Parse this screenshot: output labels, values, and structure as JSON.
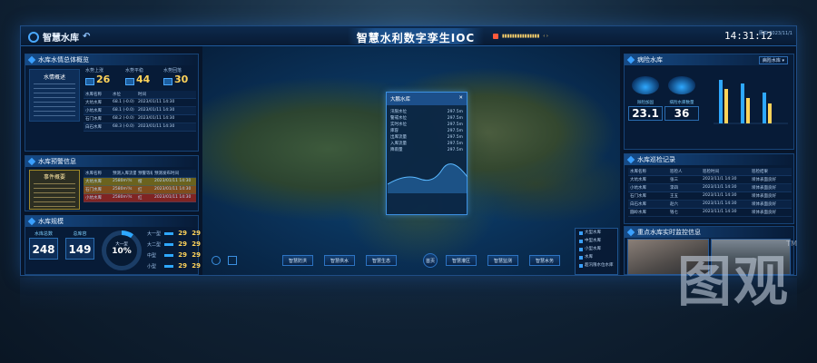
{
  "header": {
    "brand": "智慧水库",
    "title": "智慧水利数字孪生IOC",
    "time": "14:31:12",
    "date_small": "周四 2023/11/1"
  },
  "colors": {
    "accent": "#2ea8ff",
    "warning": "#ffd35a",
    "danger": "#ff5a3c"
  },
  "left": {
    "overview": {
      "title": "水库水情总体概览",
      "box_title": "水情概述",
      "stats": [
        {
          "label": "水势上涨",
          "value": "26"
        },
        {
          "label": "水势平稳",
          "value": "44"
        },
        {
          "label": "水势回落",
          "value": "30"
        }
      ],
      "table_header": [
        "水库名称",
        "水位",
        "时间"
      ],
      "table_rows": [
        [
          "大坑水库",
          "68.1 (-0.0)",
          "2023/01/11 14:30"
        ],
        [
          "小坑水库",
          "68.1 (-0.0)",
          "2023/01/11 14:30"
        ],
        [
          "石门水库",
          "68.2 (-0.0)",
          "2023/01/11 14:30"
        ],
        [
          "白石水库",
          "68.3 (-0.0)",
          "2023/01/11 14:30"
        ]
      ]
    },
    "warning": {
      "title": "水库预警信息",
      "box_title": "事件概要",
      "table_header": [
        "水库名称",
        "预测入库流量",
        "预警等级",
        "预测发布时间"
      ],
      "table_rows": [
        [
          "大坑水库",
          "2580m³/s",
          "橙",
          "2023/01/11 14:30"
        ],
        [
          "石门水库",
          "2580m³/s",
          "红",
          "2023/01/11 14:30"
        ],
        [
          "小坑水库",
          "2580m³/s",
          "红",
          "2023/01/11 14:30"
        ]
      ]
    },
    "scale": {
      "title": "水库规模",
      "total_label": "水库总数",
      "total": "248",
      "capacity_label": "总库容",
      "capacity": "149",
      "donut_label": "大一型",
      "donut_value": "10%",
      "donut_fraction": 0.1,
      "legend": [
        {
          "label": "大一型",
          "value": "29",
          "v2": "29"
        },
        {
          "label": "大二型",
          "value": "29",
          "v2": "29"
        },
        {
          "label": "中型",
          "value": "29",
          "v2": "29"
        },
        {
          "label": "小型",
          "value": "29",
          "v2": "29"
        }
      ]
    }
  },
  "popup": {
    "title": "大鹏水库",
    "kv": [
      [
        "汛限水位",
        "297.5m"
      ],
      [
        "警戒水位",
        "297.5m"
      ],
      [
        "实时水位",
        "297.5m"
      ],
      [
        "库容",
        "297.5m"
      ],
      [
        "出库流量",
        "297.5m"
      ],
      [
        "入库流量",
        "297.5m"
      ],
      [
        "降雨量",
        "297.5m"
      ]
    ]
  },
  "bottom_buttons": [
    "智慧防洪",
    "智慧供水",
    "智慧生态",
    "首页",
    "智慧灌区",
    "智慧监测",
    "智慧水务"
  ],
  "map_legend": [
    "大型水库",
    "中型水库",
    "小型水库",
    "水库",
    "超汛限水位水库"
  ],
  "right": {
    "reservoir": {
      "title": "病险水库",
      "select_value": "病险水库",
      "left_label": "除险加固",
      "left_value": "23.1",
      "right_label": "病险水库数量",
      "right_value": "36"
    },
    "patrol": {
      "title": "水库巡检记录",
      "table_header": [
        "水库名称",
        "巡检人",
        "巡检时间",
        "巡检结果"
      ],
      "table_rows": [
        [
          "大坑水库",
          "张三",
          "2023/11/1 14:30",
          "坝体表面良好"
        ],
        [
          "小坑水库",
          "李四",
          "2023/11/1 14:30",
          "坝体表面良好"
        ],
        [
          "石门水库",
          "王五",
          "2023/11/1 14:30",
          "坝体表面良好"
        ],
        [
          "白石水库",
          "赵六",
          "2023/11/1 14:30",
          "坝体表面良好"
        ],
        [
          "圆岭水库",
          "钱七",
          "2023/11/1 14:30",
          "坝体表面良好"
        ]
      ]
    },
    "camera": {
      "title": "重点水库实时监控信息"
    }
  },
  "watermark": "图观",
  "trademark": "TM"
}
